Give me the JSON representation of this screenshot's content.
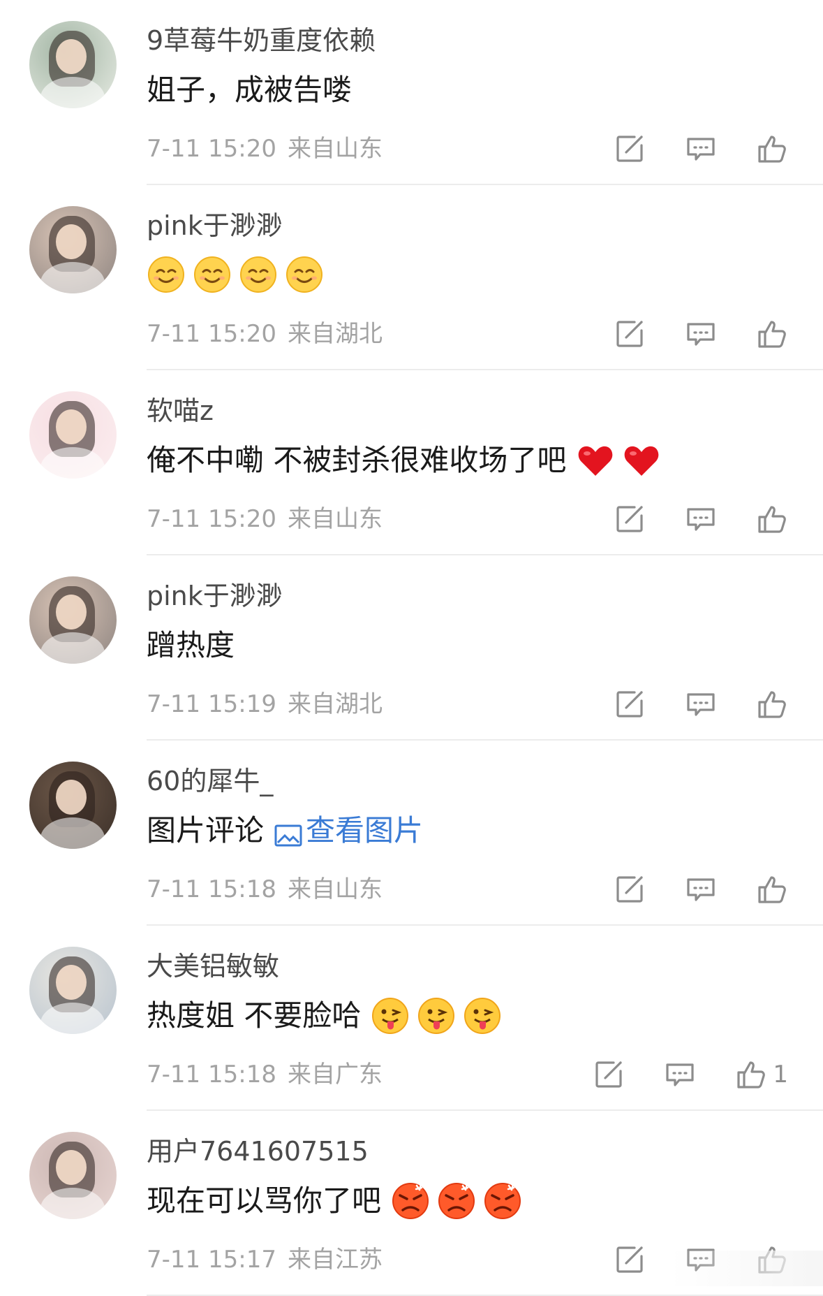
{
  "comments": [
    {
      "username": "9草莓牛奶重度依赖",
      "text": "姐子，成被告喽",
      "emojis": [],
      "time": "7-11 15:20",
      "location": "来自山东",
      "like_count": "",
      "avatar_colors": [
        "#e8ece4",
        "#a3b6a5"
      ]
    },
    {
      "username": "pink于渺渺",
      "text": "",
      "emojis": [
        "smile-emoji",
        "smile-emoji",
        "smile-emoji",
        "smile-emoji"
      ],
      "time": "7-11 15:20",
      "location": "来自湖北",
      "like_count": "",
      "avatar_colors": [
        "#8d8480",
        "#d7c2b4"
      ]
    },
    {
      "username": "软喵z",
      "text": "俺不中嘞 不被封杀很难收场了吧",
      "emojis": [
        "heart-emoji",
        "heart-emoji"
      ],
      "time": "7-11 15:20",
      "location": "来自山东",
      "like_count": "",
      "avatar_colors": [
        "#fbeef0",
        "#f7dfe3"
      ]
    },
    {
      "username": "pink于渺渺",
      "text": "蹭热度",
      "emojis": [],
      "time": "7-11 15:19",
      "location": "来自湖北",
      "like_count": "",
      "avatar_colors": [
        "#8d8480",
        "#d7c2b4"
      ]
    },
    {
      "username": "60的犀牛_",
      "text": "图片评论",
      "link_text": "查看图片",
      "emojis": [],
      "time": "7-11 15:18",
      "location": "来自山东",
      "like_count": "",
      "avatar_colors": [
        "#3a2f28",
        "#6b5647"
      ]
    },
    {
      "username": "大美铝敏敏",
      "text": "热度姐 不要脸哈",
      "emojis": [
        "tongue-emoji",
        "tongue-emoji",
        "tongue-emoji"
      ],
      "time": "7-11 15:18",
      "location": "来自广东",
      "like_count": "1",
      "avatar_colors": [
        "#b7c3cf",
        "#e8e6e0"
      ]
    },
    {
      "username": "用户7641607515",
      "text": "现在可以骂你了吧",
      "emojis": [
        "angry-emoji",
        "angry-emoji",
        "angry-emoji"
      ],
      "time": "7-11 15:17",
      "location": "来自江苏",
      "like_count": "",
      "avatar_colors": [
        "#e8d6d3",
        "#cdb8b4"
      ]
    }
  ],
  "colors": {
    "username": "#4a4a4a",
    "content": "#1a1a1a",
    "meta": "#a3a3a3",
    "link": "#3a7bd5",
    "divider": "#ececec"
  }
}
